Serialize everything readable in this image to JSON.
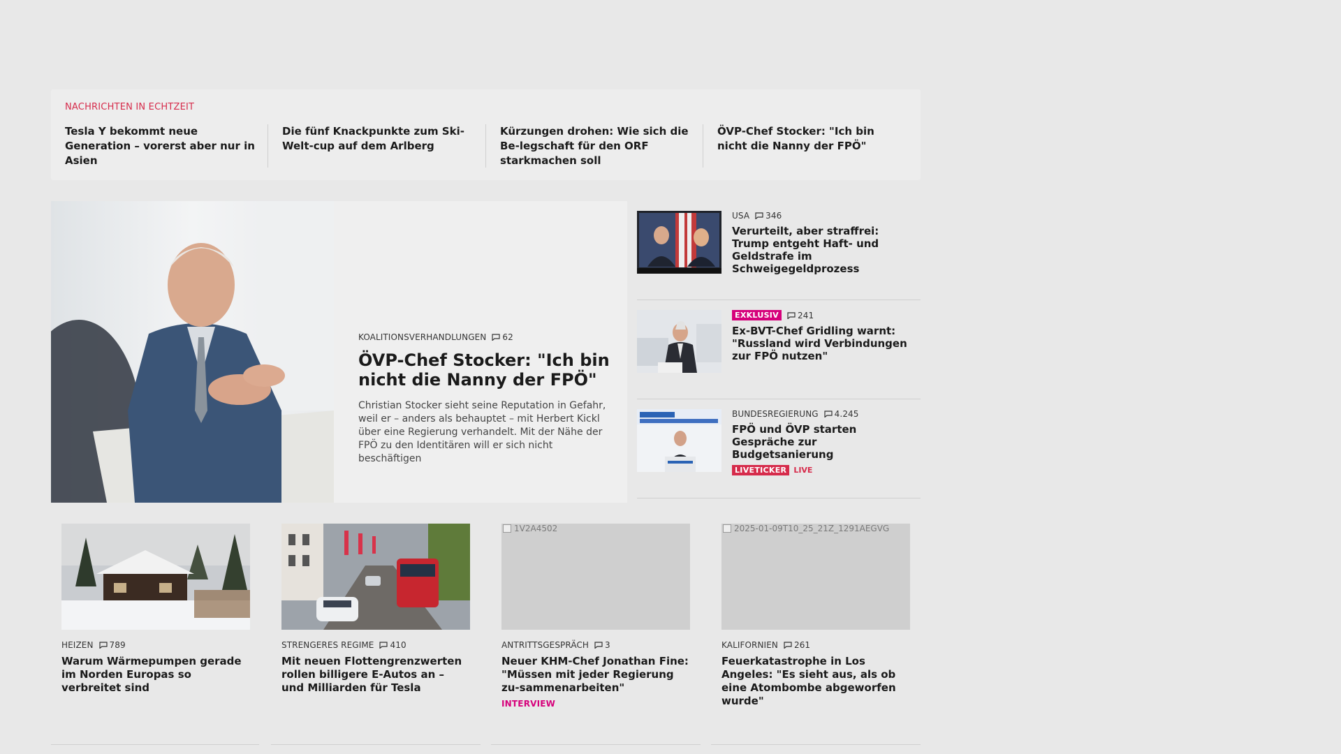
{
  "ticker": {
    "heading": "NACHRICHTEN IN ECHTZEIT",
    "items": [
      "Tesla Y bekommt neue Generation – vorerst aber nur in Asien",
      "Die fünf Knackpunkte zum Ski-Welt-cup auf dem Arlberg",
      "Kürzungen drohen: Wie sich die Be-legschaft für den ORF starkmachen soll",
      "ÖVP-Chef Stocker: \"Ich bin nicht die Nanny der FPÖ\""
    ]
  },
  "lead": {
    "category": "KOALITIONSVERHANDLUNGEN",
    "comments": "62",
    "title": "ÖVP-Chef Stocker: \"Ich bin nicht die Nanny der FPÖ\"",
    "teaser": "Christian Stocker sieht seine Reputation in Gefahr, weil er – anders als behauptet – mit Herbert Kickl über eine Regierung verhandelt. Mit der Nähe der FPÖ zu den Identitären will er sich nicht beschäftigen"
  },
  "side": [
    {
      "category": "USA",
      "comments": "346",
      "title": "Verurteilt, aber straffrei: Trump entgeht Haft- und Geldstrafe im Schweigegeldprozess"
    },
    {
      "badge": "EXKLUSIV",
      "comments": "241",
      "title": "Ex-BVT-Chef Gridling warnt: \"Russland wird Verbindungen zur FPÖ nutzen\""
    },
    {
      "category": "BUNDESREGIERUNG",
      "comments": "4.245",
      "title": "FPÖ und ÖVP starten Gespräche zur Budgetsanierung",
      "badge": "LIVETICKER",
      "live": "LIVE"
    }
  ],
  "cards": [
    {
      "category": "HEIZEN",
      "comments": "789",
      "title": "Warum Wärmepumpen gerade im Norden Europas so verbreitet sind"
    },
    {
      "category": "STRENGERES REGIME",
      "comments": "410",
      "title": "Mit neuen Flottengrenzwerten rollen billigere E-Autos an – und Milliarden für Tesla"
    },
    {
      "category": "ANTRITTSGESPRÄCH",
      "comments": "3",
      "title": "Neuer KHM-Chef Jonathan Fine: \"Müssen mit jeder Regierung zu-sammenarbeiten\"",
      "tag": "INTERVIEW",
      "img_alt": "1V2A4502"
    },
    {
      "category": "KALIFORNIEN",
      "comments": "261",
      "title": "Feuerkatastrophe in Los Angeles: \"Es sieht aus, als ob eine Atombombe abgeworfen wurde\"",
      "img_alt": "2025-01-09T10_25_21Z_1291AEGVG"
    }
  ],
  "colors": {
    "accent_red": "#d62b4b",
    "accent_magenta": "#d6007b",
    "background": "#e8e8e8"
  }
}
